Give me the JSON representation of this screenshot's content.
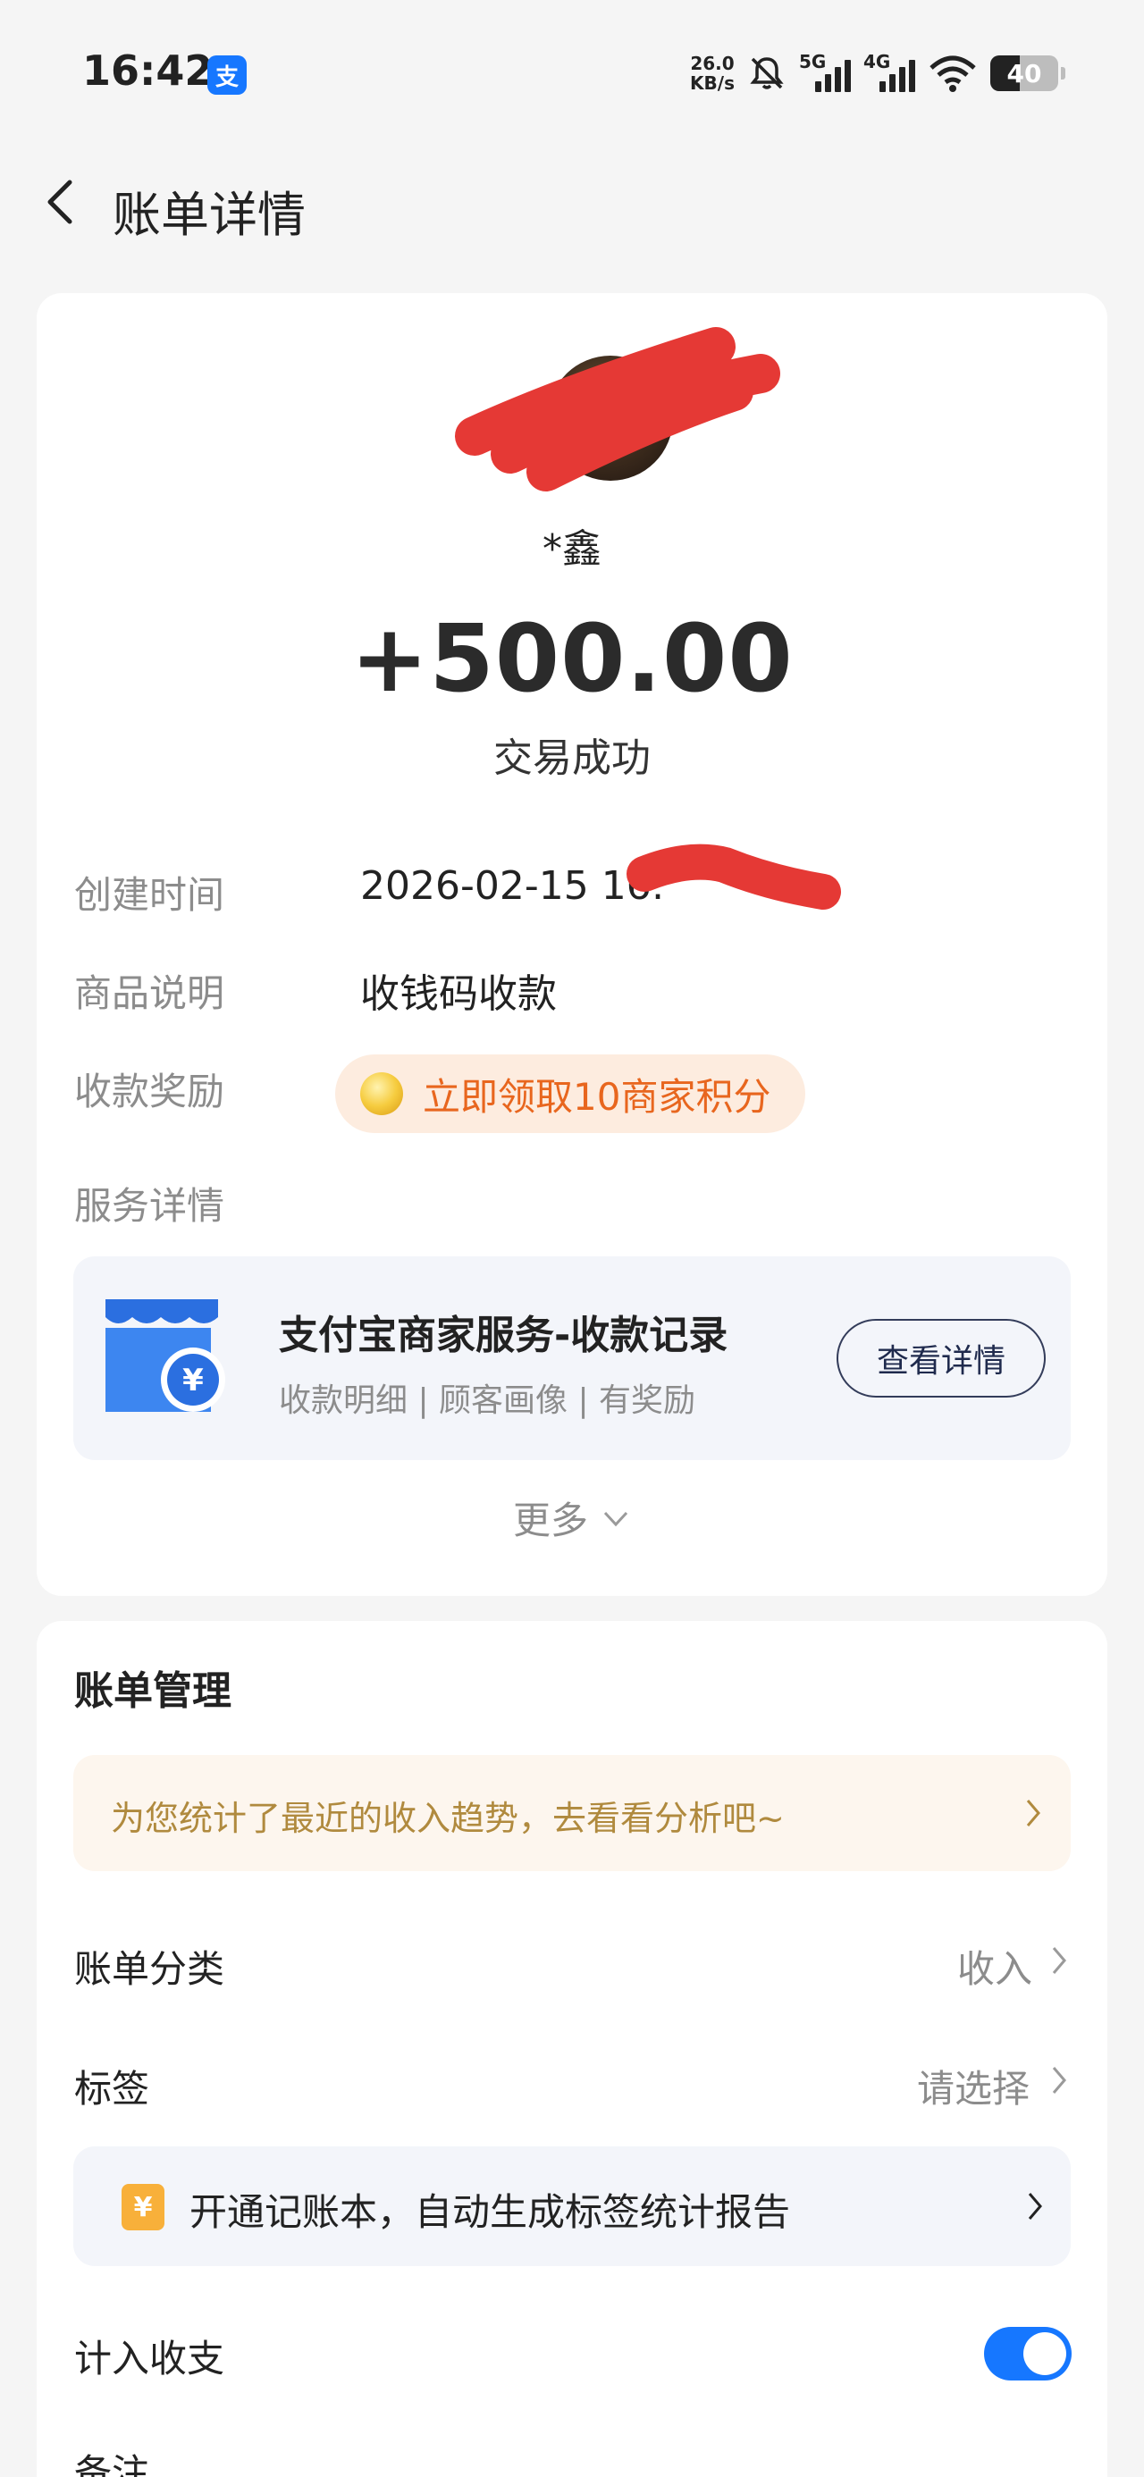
{
  "status_bar": {
    "time": "16:42",
    "app_badge": "支",
    "net_speed_value": "26.0",
    "net_speed_unit": "KB/s",
    "signal_1_label": "5G",
    "signal_2_label": "4G",
    "battery": "40",
    "battery_level": 0.4,
    "icons": [
      "bell-off-icon",
      "signal-icon",
      "wifi-icon",
      "battery-icon"
    ]
  },
  "header": {
    "title": "账单详情"
  },
  "transaction": {
    "payer_name": "*鑫",
    "amount": "+500.00",
    "status": "交易成功",
    "rows": [
      {
        "label": "创建时间",
        "value": "2026-02-15 16:"
      },
      {
        "label": "商品说明",
        "value": "收钱码收款"
      },
      {
        "label": "收款奖励",
        "value": ""
      },
      {
        "label": "服务详情",
        "value": ""
      }
    ],
    "reward_text": "立即领取10商家积分"
  },
  "service": {
    "title": "支付宝商家服务-收款记录",
    "subtitle": "收款明细 | 顾客画像 | 有奖励",
    "button": "查看详情"
  },
  "more_label": "更多",
  "management": {
    "title": "账单管理",
    "trend_text": "为您统计了最近的收入趋势，去看看分析吧~",
    "category_label": "账单分类",
    "category_value": "收入",
    "tag_label": "标签",
    "tag_value": "请选择",
    "book_text": "开通记账本，自动生成标签统计报告",
    "include_label": "计入收支",
    "include_on": true,
    "note_label": "备注"
  },
  "colors": {
    "accent": "#1677ff",
    "reward_orange": "#e8661e",
    "trend_gold": "#b08a3e",
    "redaction_red": "#e53935"
  }
}
